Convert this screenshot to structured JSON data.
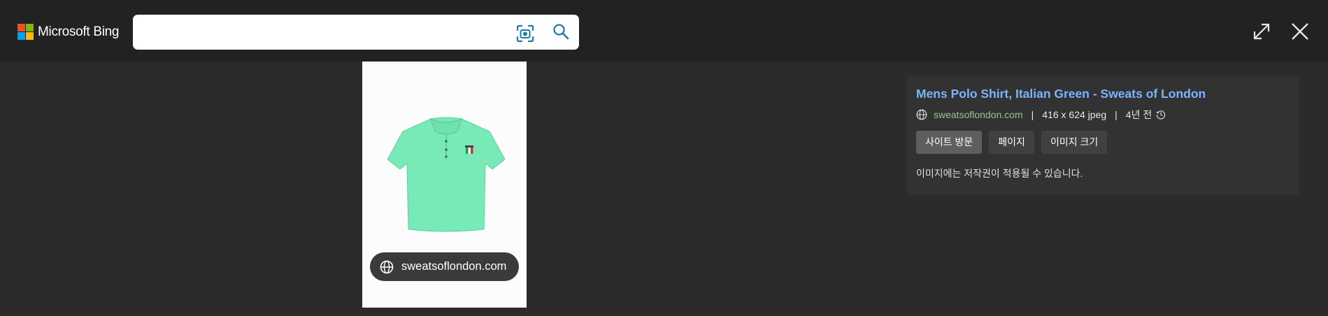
{
  "header": {
    "brand": "Microsoft Bing",
    "logo_colors": [
      "#f25022",
      "#7fba00",
      "#00a4ef",
      "#ffb900"
    ],
    "search": {
      "value": "",
      "placeholder": ""
    },
    "icons": [
      "visual-search-icon",
      "search-icon",
      "expand-icon",
      "close-icon"
    ],
    "accent": "#1d7ca3"
  },
  "image": {
    "subject": "polo-shirt",
    "shirt_color": "#77eab8",
    "source_label": "sweatsoflondon.com"
  },
  "details": {
    "title": "Mens Polo Shirt, Italian Green - Sweats of London",
    "domain": "sweatsoflondon.com",
    "separator": "|",
    "dimensions": "416 x 624 jpeg",
    "age": "4년 전",
    "buttons": {
      "visit": "사이트 방문",
      "page": "페이지",
      "size": "이미지 크기"
    },
    "copyright": "이미지에는 저작권이 적용될 수 있습니다.",
    "title_color": "#7ab4ff",
    "domain_color": "#9ac58d"
  }
}
